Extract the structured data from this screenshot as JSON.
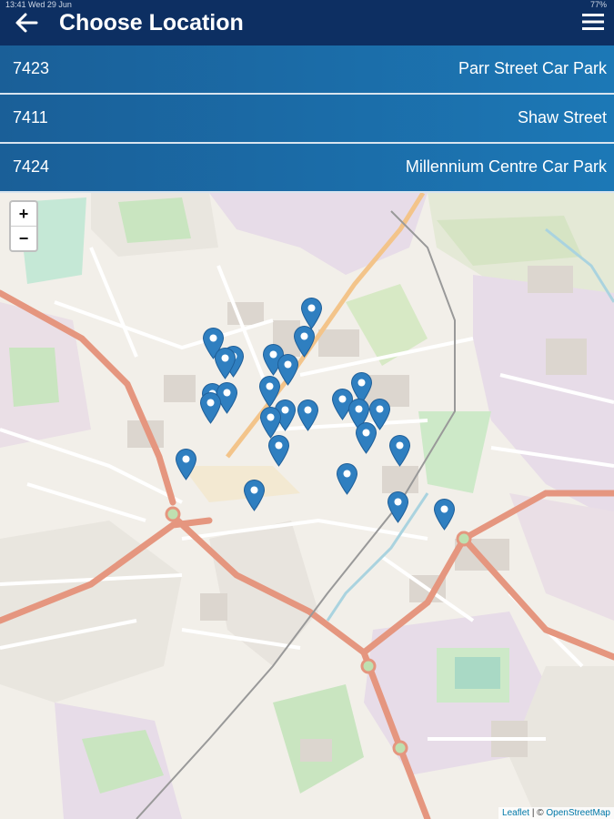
{
  "status": {
    "time": "13:41 Wed 29 Jun",
    "battery": "77%"
  },
  "header": {
    "title": "Choose Location",
    "back_icon": "arrow-left-icon",
    "menu_icon": "hamburger-menu-icon"
  },
  "locations": [
    {
      "code": "7423",
      "name": "Parr Street Car Park"
    },
    {
      "code": "7411",
      "name": "Shaw Street"
    },
    {
      "code": "7424",
      "name": "Millennium Centre Car Park"
    }
  ],
  "map": {
    "zoom_in": "+",
    "zoom_out": "−",
    "attribution_leaflet": "Leaflet",
    "attribution_sep": " | © ",
    "attribution_osm": "OpenStreetMap",
    "marker_color": "#2f7fc0"
  }
}
